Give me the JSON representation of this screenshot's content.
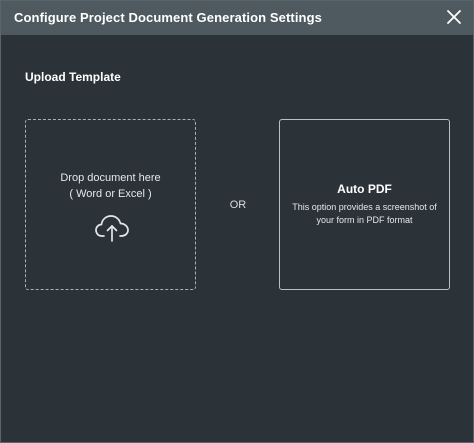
{
  "dialog": {
    "title": "Configure Project Document Generation Settings",
    "close_icon": "close-icon"
  },
  "upload": {
    "section_title": "Upload Template",
    "drop_line1": "Drop document here",
    "drop_line2": "( Word or Excel )",
    "icon": "cloud-upload-icon"
  },
  "separator": {
    "label": "OR"
  },
  "auto_pdf": {
    "title": "Auto PDF",
    "description": "This option provides a screenshot of your form in PDF format"
  },
  "colors": {
    "background": "#2b3238",
    "titlebar": "#4f5960",
    "text": "#ffffff"
  }
}
